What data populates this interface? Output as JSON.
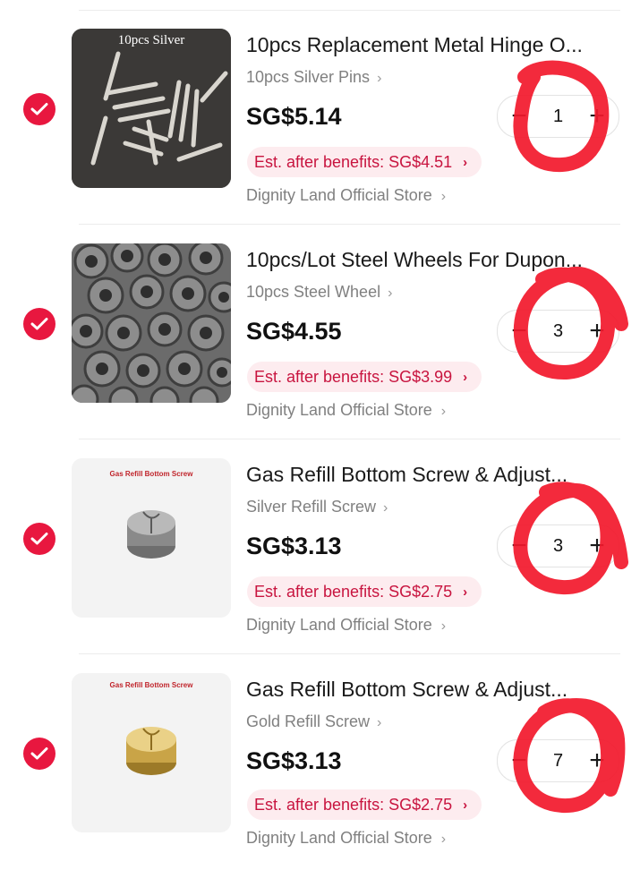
{
  "cart": {
    "items": [
      {
        "thumb_caption": "10pcs Silver",
        "title": "10pcs Replacement Metal Hinge O...",
        "variant": "10pcs Silver Pins",
        "price": "SG$5.14",
        "benefit": "Est. after benefits: SG$4.51",
        "store": "Dignity Land Official Store",
        "quantity": "1"
      },
      {
        "title": "10pcs/Lot Steel Wheels For Dupon...",
        "variant": "10pcs Steel Wheel",
        "price": "SG$4.55",
        "benefit": "Est. after benefits: SG$3.99",
        "store": "Dignity Land Official Store",
        "quantity": "3"
      },
      {
        "thumb_caption": "Gas Refill Bottom Screw",
        "title": "Gas Refill Bottom Screw & Adjust...",
        "variant": "Silver Refill Screw",
        "price": "SG$3.13",
        "benefit": "Est. after benefits: SG$2.75",
        "store": "Dignity Land Official Store",
        "quantity": "3"
      },
      {
        "thumb_caption": "Gas Refill Bottom Screw",
        "title": "Gas Refill Bottom Screw & Adjust...",
        "variant": "Gold Refill Screw",
        "price": "SG$3.13",
        "benefit": "Est. after benefits: SG$2.75",
        "store": "Dignity Land Official Store",
        "quantity": "7"
      }
    ]
  },
  "icons": {
    "check": "check-circle-icon",
    "chevron": "chevron-right-icon",
    "minus": "minus-icon",
    "plus": "plus-icon"
  },
  "colors": {
    "accent": "#e8173f",
    "benefit_bg": "#fdecef",
    "benefit_text": "#c8143f",
    "annotation": "#f2182b"
  }
}
